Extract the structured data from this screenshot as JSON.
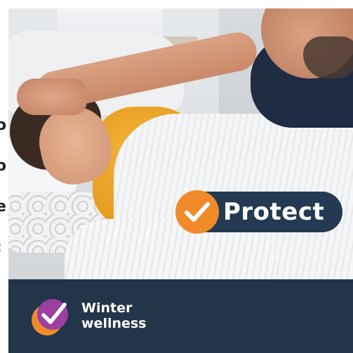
{
  "badge": {
    "label": "Protect",
    "icon": "check-icon"
  },
  "brand": {
    "line1": "Winter",
    "line2": "wellness",
    "icon": "check-logo-icon"
  },
  "edge_text": [
    "o",
    "o",
    "e",
    ":"
  ],
  "colors": {
    "banner": "#223549",
    "badge": "#233a52",
    "accent_orange": "#f08a2b",
    "accent_purple": "#9b3fa0"
  }
}
